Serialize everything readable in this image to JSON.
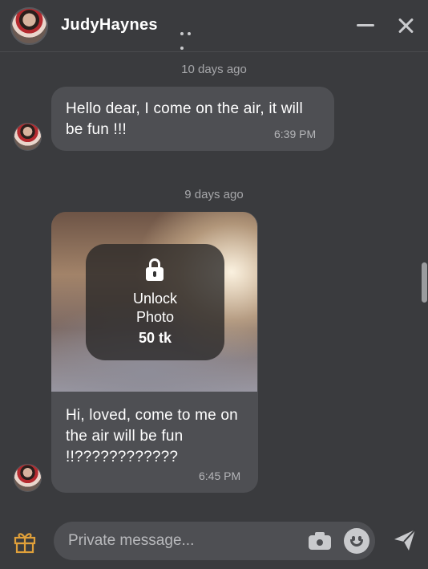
{
  "header": {
    "title": "JudyHaynes",
    "avatar_icon": "avatar",
    "more_icon": "more-icon",
    "minimize_icon": "minimize-icon",
    "close_icon": "close-icon"
  },
  "messages": [
    {
      "divider": "10 days ago",
      "text": "Hello dear, I come on the air, it will be fun !!!",
      "time": "6:39 PM"
    },
    {
      "divider": "9 days ago",
      "photo": {
        "lock_icon": "lock-icon",
        "unlock_label_line1": "Unlock",
        "unlock_label_line2": "Photo",
        "price": "50 tk"
      },
      "text": "Hi, loved, come to me on the air will be fun !!????????????",
      "time": "6:45 PM"
    }
  ],
  "composer": {
    "placeholder": "Private message...",
    "gift_icon": "gift-icon",
    "camera_icon": "camera-icon",
    "emoji_icon": "smile-icon",
    "send_icon": "send-icon"
  },
  "colors": {
    "background": "#3a3b3e",
    "bubble": "#4e4f53",
    "accent_gift": "#e0a03a",
    "icon": "#c9cacd"
  }
}
